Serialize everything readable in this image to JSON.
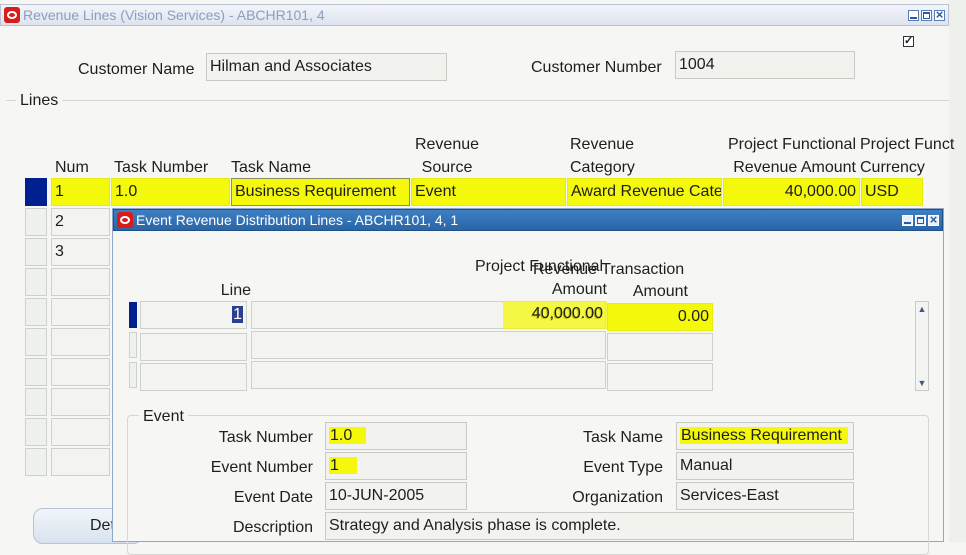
{
  "window": {
    "title": "Revenue Lines (Vision Services) - ABCHR101, 4",
    "checkbox_checked": true
  },
  "header": {
    "customer_name_label": "Customer Name",
    "customer_name": "Hilman and Associates",
    "customer_number_label": "Customer Number",
    "customer_number": "1004"
  },
  "lines": {
    "group_label": "Lines",
    "columns": {
      "num": "Num",
      "task_number": "Task  Number",
      "task_name": "Task  Name",
      "revenue_source_1": "Revenue",
      "revenue_source_2": "Source",
      "revenue_category_1": "Revenue",
      "revenue_category_2": "Category",
      "pf_amount_1": "Project Functional",
      "pf_amount_2": "Revenue Amount",
      "pf_currency_1": "Project Funct",
      "pf_currency_2": "Currency"
    },
    "rows": [
      {
        "num": "1",
        "task_number": "1.0",
        "task_name": "Business Requirement",
        "revenue_source": "Event",
        "revenue_category": "Award Revenue Cate",
        "amount": "40,000.00",
        "currency": "USD"
      },
      {
        "num": "2"
      },
      {
        "num": "3"
      }
    ],
    "details_button": "Det"
  },
  "dialog": {
    "title": "Event Revenue Distribution Lines - ABCHR101, 4, 1",
    "columns": {
      "line": "Line",
      "pf_amount_1": "Project Functional",
      "pf_amount_2": "Amount",
      "rev_txn_1": "Revenue Transaction",
      "rev_txn_2": "Amount"
    },
    "rows": [
      {
        "line": "1",
        "pf_amount": "40,000.00",
        "txn_amount": "0.00"
      }
    ],
    "event": {
      "group_label": "Event",
      "task_number_label": "Task Number",
      "task_number": "1.0",
      "task_name_label": "Task Name",
      "task_name": "Business Requirement",
      "event_number_label": "Event Number",
      "event_number": "1",
      "event_type_label": "Event Type",
      "event_type": "Manual",
      "event_date_label": "Event Date",
      "event_date": "10-JUN-2005",
      "organization_label": "Organization",
      "organization": "Services-East",
      "description_label": "Description",
      "description": "Strategy and Analysis phase is complete."
    }
  },
  "colors": {
    "highlight": "#f4f80a",
    "current_row": "#00208f",
    "title_active": "#2a66a8"
  },
  "icons": [
    "oracle-logo-icon",
    "minimize-icon",
    "maximize-icon",
    "close-icon",
    "scroll-up-icon",
    "scroll-down-icon"
  ]
}
